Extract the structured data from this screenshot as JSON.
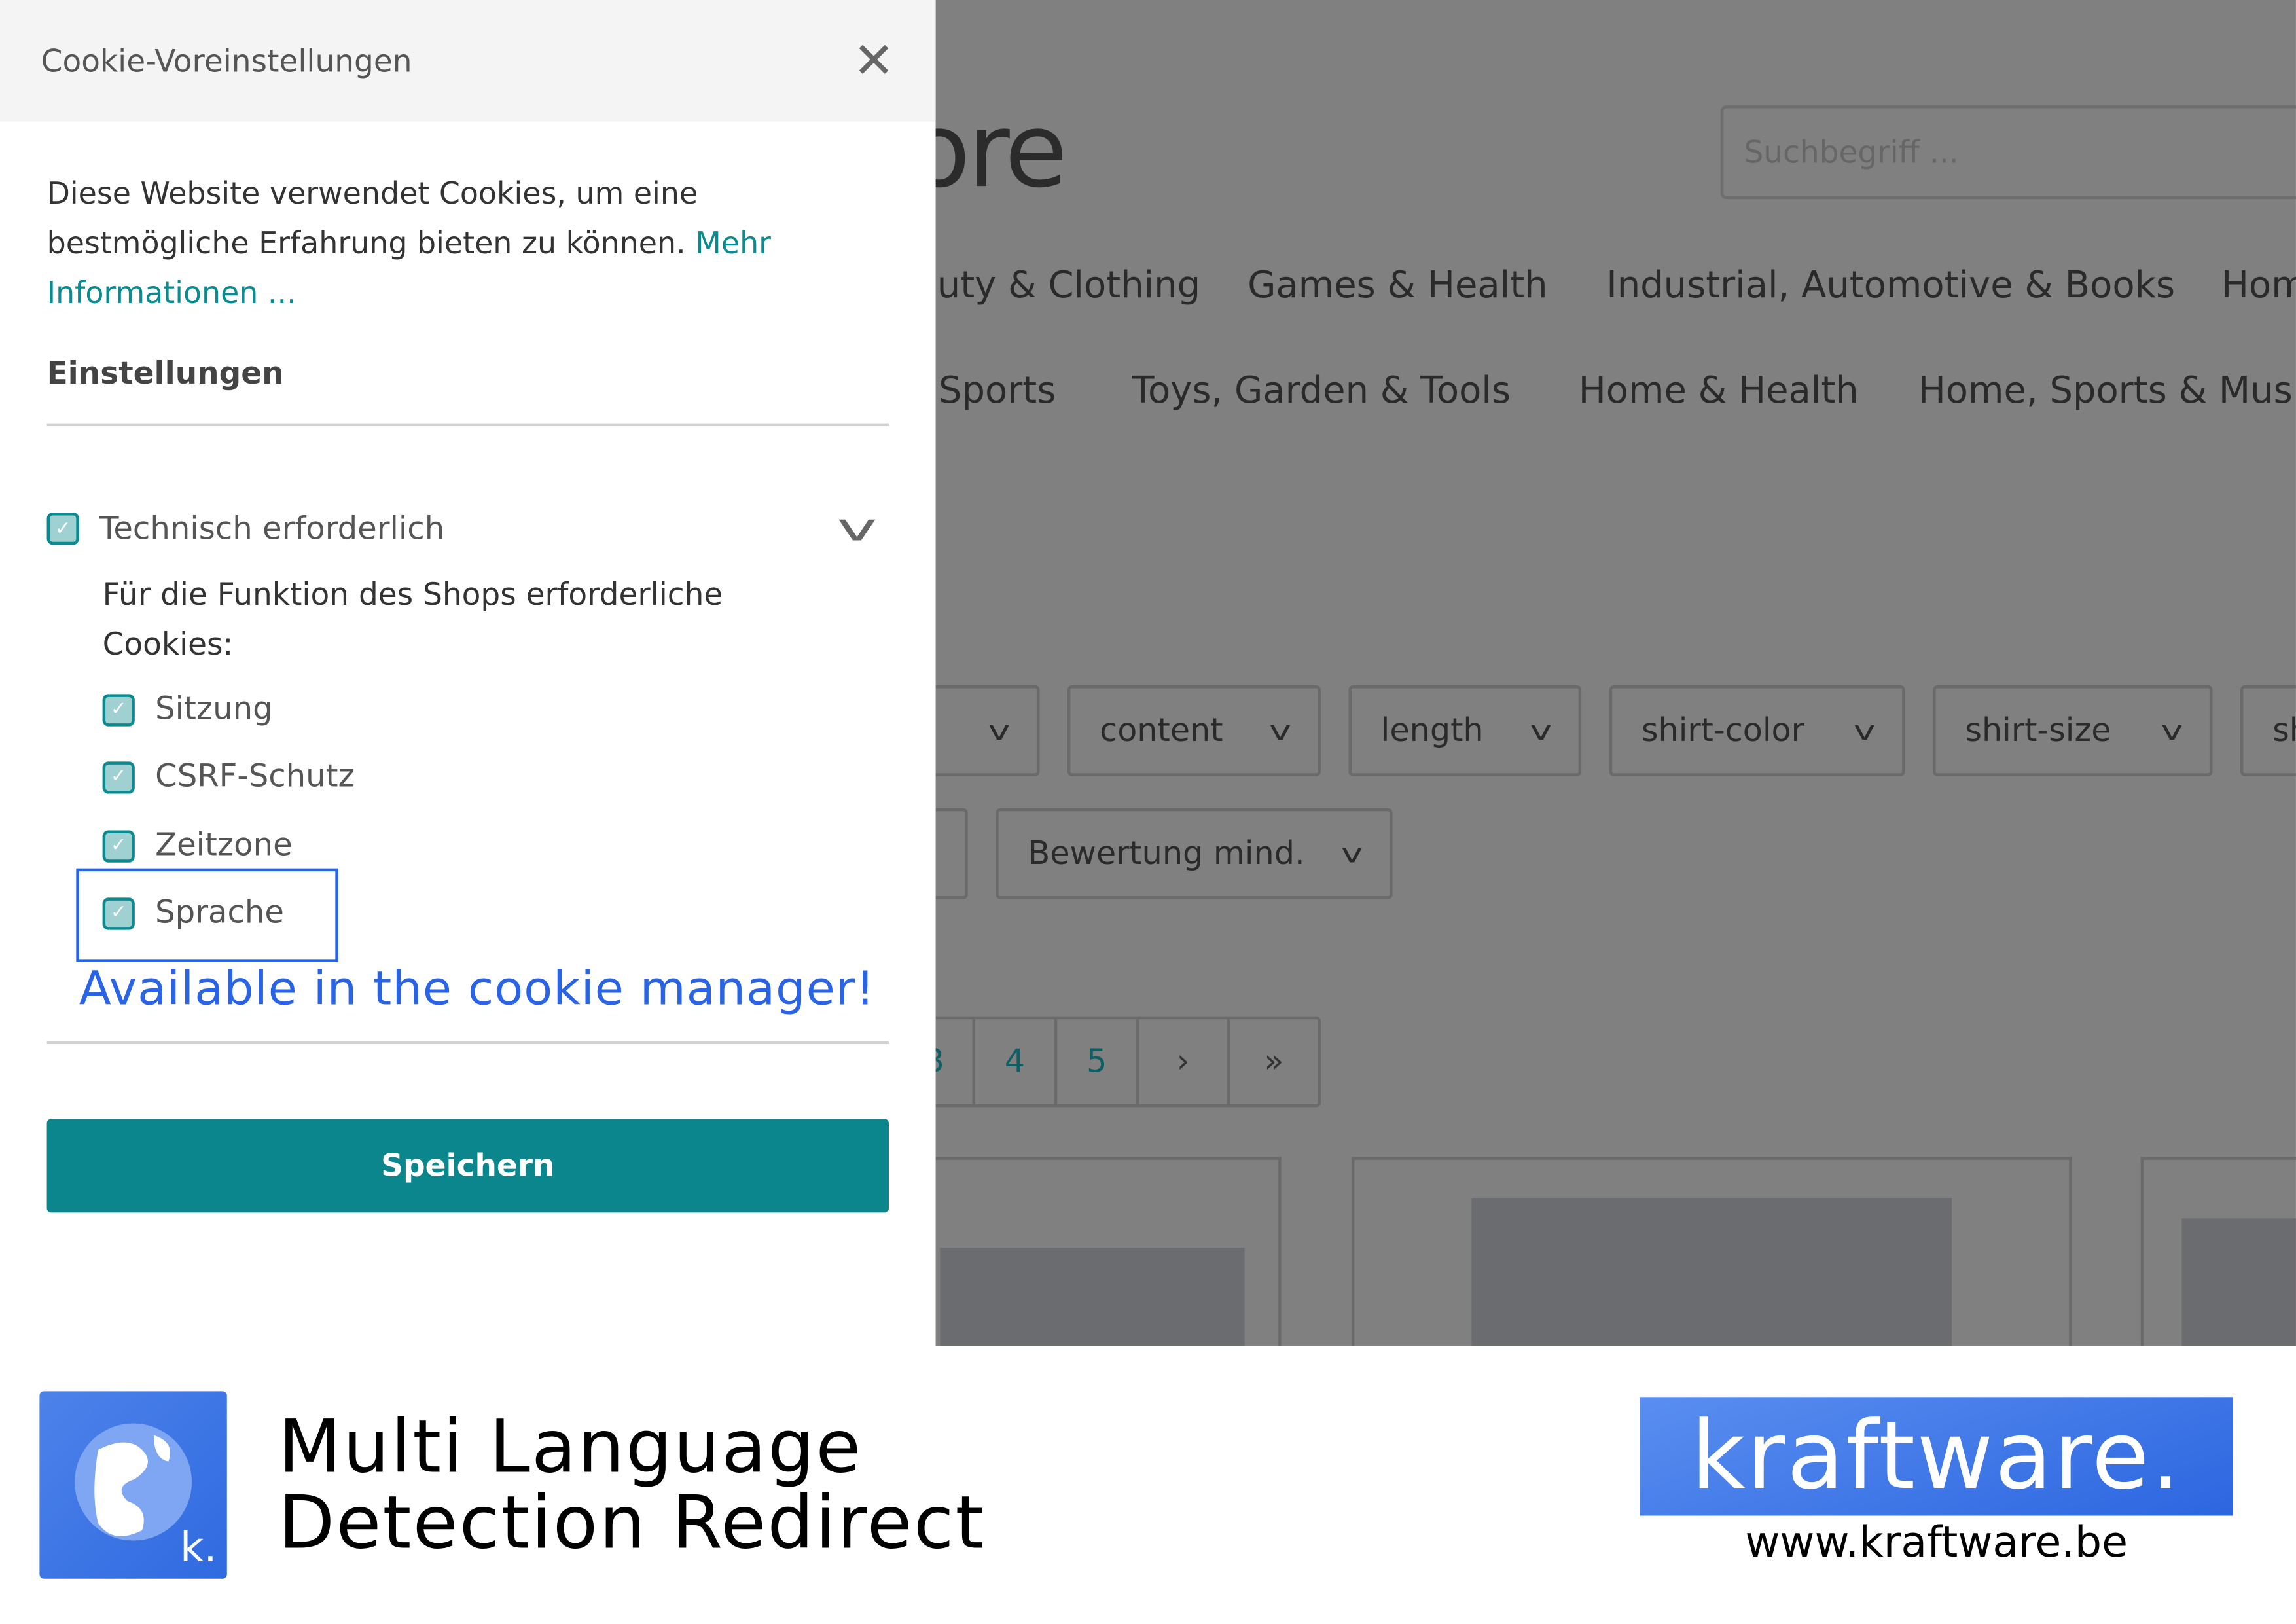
{
  "background": {
    "logo_partial": "ore",
    "search_placeholder": "Suchbegriff ...",
    "nav_row1": [
      "uty & Clothing",
      "Games & Health",
      "Industrial, Automotive & Books",
      "Hom"
    ],
    "nav_row2": [
      "Sports",
      "Toys, Garden & Tools",
      "Home & Health",
      "Home, Sports & Music"
    ],
    "filters_row1": [
      "",
      "content",
      "length",
      "shirt-color",
      "shirt-size",
      "sh"
    ],
    "filters_row2": [
      "",
      "Bewertung mind."
    ],
    "pagination": [
      "3",
      "4",
      "5",
      "›",
      "»"
    ]
  },
  "cookie_panel": {
    "title": "Cookie-Voreinstellungen",
    "intro": "Diese Website verwendet Cookies, um eine bestmögliche Erfahrung bieten zu können.",
    "more_link": "Mehr Informationen ...",
    "settings_heading": "Einstellungen",
    "group_label": "Technisch erforderlich",
    "group_description": "Für die Funktion des Shops erforderliche Cookies:",
    "items": [
      {
        "label": "Sitzung",
        "checked": true
      },
      {
        "label": "CSRF-Schutz",
        "checked": true
      },
      {
        "label": "Zeitzone",
        "checked": true
      },
      {
        "label": "Sprache",
        "checked": true
      }
    ],
    "save_label": "Speichern",
    "annotation": "Available in the cookie manager!",
    "accent_color": "#0b868c",
    "annotation_color": "#2a64e6"
  },
  "footer": {
    "product_title_line1": "Multi Language",
    "product_title_line2": "Detection Redirect",
    "app_icon_letter": "k.",
    "brand": "kraftware.",
    "url": "www.kraftware.be"
  }
}
